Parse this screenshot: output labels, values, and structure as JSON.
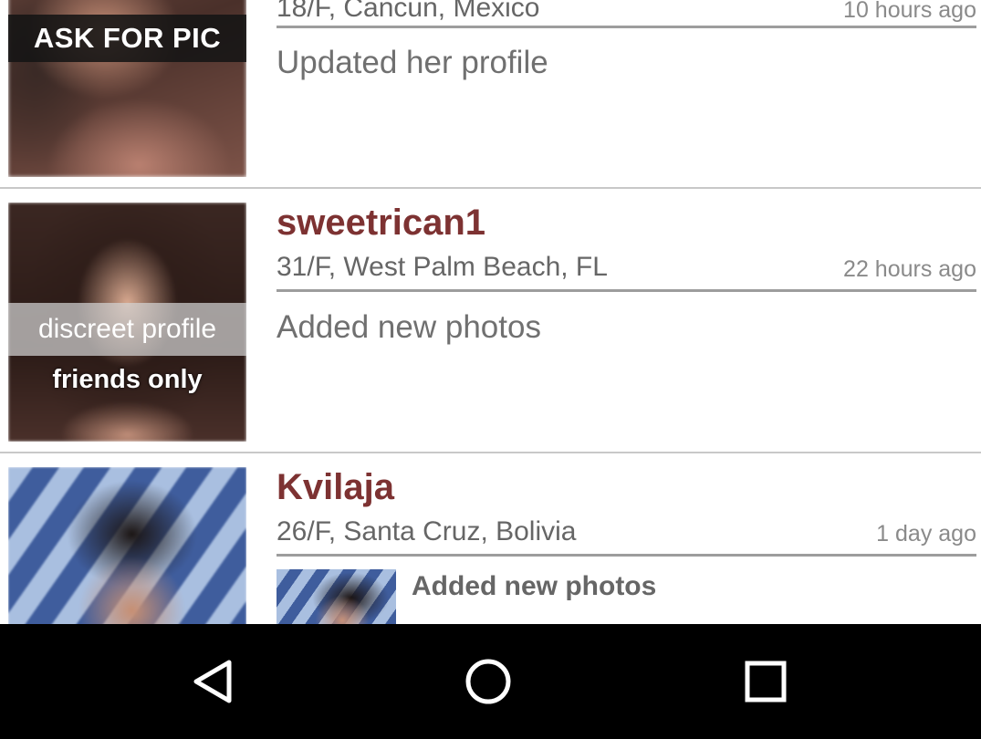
{
  "feed": {
    "items": [
      {
        "username": "",
        "details": "18/F, Cancun, Mexico",
        "time": "10 hours ago",
        "activity": "Updated her profile",
        "photo_overlay": "ASK FOR PIC",
        "photo_icon": "blurred-profile-photo"
      },
      {
        "username": "sweetrican1",
        "details": "31/F, West Palm Beach, FL",
        "time": "22 hours ago",
        "activity": "Added new photos",
        "photo_overlay": "discreet profile",
        "photo_overlay_2": "friends only",
        "photo_icon": "profile-photo"
      },
      {
        "username": "Kvilaja",
        "details": "26/F, Santa Cruz, Bolivia",
        "time": "1 day ago",
        "activity": "Added new photos",
        "photo_icon": "profile-photo",
        "thumb_icon": "new-photo-thumbnail"
      }
    ]
  },
  "navbar": {
    "back_icon": "back-triangle-icon",
    "home_icon": "home-circle-icon",
    "recents_icon": "recents-square-icon"
  },
  "colors": {
    "username": "#7d3232",
    "divider": "#c8c8c8",
    "underline": "#9d9d9d",
    "navbar": "#000000"
  }
}
